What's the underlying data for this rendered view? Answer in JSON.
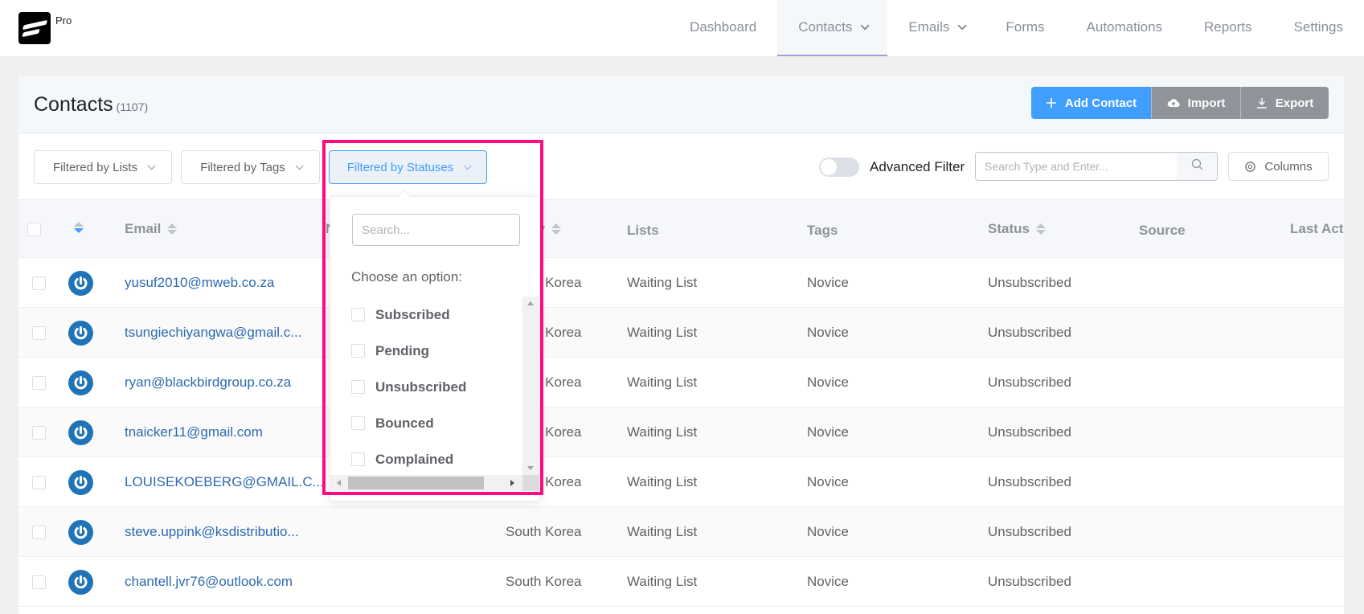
{
  "app": {
    "badge": "Pro"
  },
  "nav": {
    "items": [
      {
        "label": "Dashboard",
        "active": false,
        "dropdown": false
      },
      {
        "label": "Contacts",
        "active": true,
        "dropdown": true
      },
      {
        "label": "Emails",
        "active": false,
        "dropdown": true
      },
      {
        "label": "Forms",
        "active": false,
        "dropdown": false
      },
      {
        "label": "Automations",
        "active": false,
        "dropdown": false
      },
      {
        "label": "Reports",
        "active": false,
        "dropdown": false
      },
      {
        "label": "Settings",
        "active": false,
        "dropdown": false
      }
    ]
  },
  "header": {
    "title": "Contacts",
    "count": "(1107)",
    "buttons": {
      "add": "Add Contact",
      "import": "Import",
      "export": "Export"
    }
  },
  "filters": {
    "lists": "Filtered by Lists",
    "tags": "Filtered by Tags",
    "statuses": "Filtered by Statuses",
    "advanced_label": "Advanced Filter",
    "advanced_on": false,
    "search_placeholder": "Search Type and Enter...",
    "columns_label": "Columns"
  },
  "status_popover": {
    "search_placeholder": "Search...",
    "prompt": "Choose an option:",
    "options": [
      "Subscribed",
      "Pending",
      "Unsubscribed",
      "Bounced",
      "Complained"
    ]
  },
  "table": {
    "columns": {
      "email": "Email",
      "name": "Name",
      "country": "Country",
      "lists": "Lists",
      "tags": "Tags",
      "status": "Status",
      "source": "Source",
      "last_activity": "Last Activity"
    },
    "rows": [
      {
        "email": "yusuf2010@mweb.co.za",
        "country": "South Korea",
        "lists": "Waiting List",
        "tags": "Novice",
        "status": "Unsubscribed",
        "source": ""
      },
      {
        "email": "tsungiechiyangwa@gmail.c...",
        "country": "South Korea",
        "lists": "Waiting List",
        "tags": "Novice",
        "status": "Unsubscribed",
        "source": ""
      },
      {
        "email": "ryan@blackbirdgroup.co.za",
        "country": "South Korea",
        "lists": "Waiting List",
        "tags": "Novice",
        "status": "Unsubscribed",
        "source": ""
      },
      {
        "email": "tnaicker11@gmail.com",
        "country": "South Korea",
        "lists": "Waiting List",
        "tags": "Novice",
        "status": "Unsubscribed",
        "source": ""
      },
      {
        "email": "LOUISEKOEBERG@GMAIL.C...",
        "country": "South Korea",
        "lists": "Waiting List",
        "tags": "Novice",
        "status": "Unsubscribed",
        "source": ""
      },
      {
        "email": "steve.uppink@ksdistributio...",
        "country": "South Korea",
        "lists": "Waiting List",
        "tags": "Novice",
        "status": "Unsubscribed",
        "source": ""
      },
      {
        "email": "chantell.jvr76@outlook.com",
        "country": "South Korea",
        "lists": "Waiting List",
        "tags": "Novice",
        "status": "Unsubscribed",
        "source": ""
      }
    ]
  },
  "colors": {
    "primary": "#409eff",
    "secondary_button": "#909399",
    "active_tab_border": "#a29bd6",
    "email_link": "#2d6ab0",
    "avatar": "#1f74b7",
    "highlight": "#ff0a84"
  }
}
